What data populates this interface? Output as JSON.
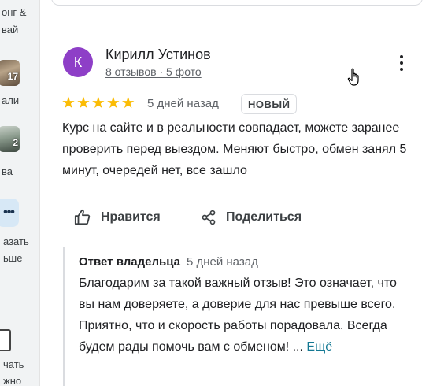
{
  "rail": {
    "item1_label_line1": "онг &",
    "item1_label_line2": "вай",
    "item2_badge": "17",
    "item2_label": "али",
    "item3_badge": "2",
    "item3_label": "ва",
    "more_label_line1": "азать",
    "more_label_line2": "ьше",
    "doc_label_line1": "чать",
    "doc_label_line2": "жно"
  },
  "review": {
    "avatar_letter": "К",
    "author": "Кирилл Устинов",
    "meta": "8 отзывов · 5 фото",
    "rating": 5,
    "date": "5 дней назад",
    "badge": "НОВЫЙ",
    "text": "Курс на сайте и в реальности совпадает, можете заранее проверить перед выездом. Меняют быстро, обмен занял 5 минут, очередей нет, все зашло"
  },
  "actions": {
    "like_label": "Нравится",
    "share_label": "Поделиться"
  },
  "owner_reply": {
    "author": "Ответ владельца",
    "date": "5 дней назад",
    "text": "Благодарим за такой важный отзыв! Это означает, что вы нам доверяете, а доверие для нас превыше всего. Приятно, что и скорость работы порадовала. Всегда будем рады помочь вам с обменом! ...",
    "more_label": "Ещё"
  },
  "icons": {
    "like": "thumbs-up-icon",
    "share": "share-icon",
    "menu": "more-vert-icon",
    "star_color": "#fbbc04"
  }
}
